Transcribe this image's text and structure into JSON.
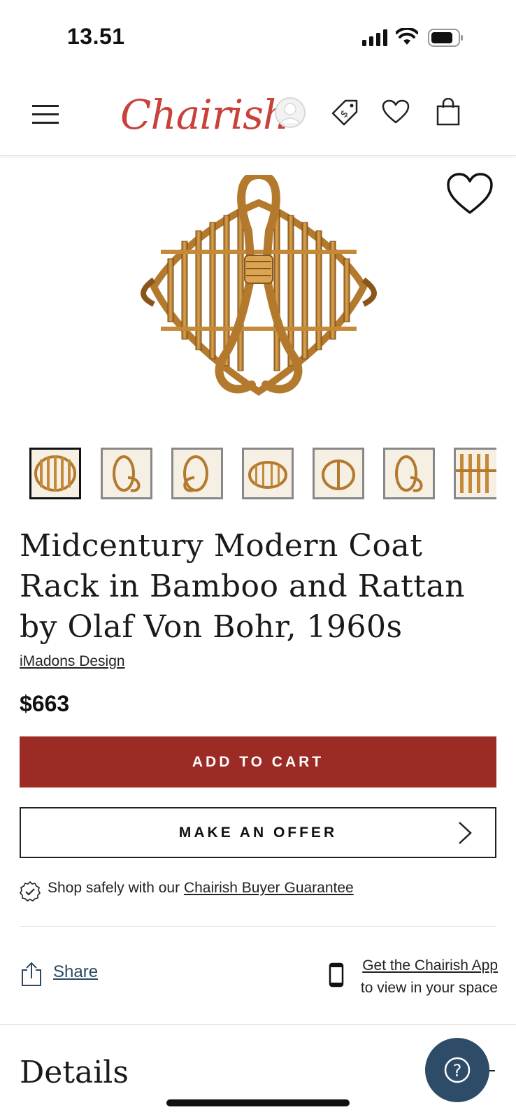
{
  "status_bar": {
    "time": "13.51"
  },
  "header": {
    "logo": "Chairish"
  },
  "thumbnails": {
    "count": 7,
    "active_index": 0
  },
  "product": {
    "title": "Midcentury Modern Coat Rack in Bamboo and Rattan by Olaf Von Bohr, 1960s",
    "seller": "iMadons Design",
    "price": "$663"
  },
  "actions": {
    "add_to_cart": "ADD TO CART",
    "make_offer": "MAKE AN OFFER"
  },
  "guarantee": {
    "prefix": "Shop safely with our ",
    "link": "Chairish Buyer Guarantee"
  },
  "share": {
    "label": "Share"
  },
  "app_promo": {
    "link": "Get the Chairish App",
    "subtitle": "to view in your space"
  },
  "details": {
    "heading": "Details"
  },
  "help": {
    "label": "?"
  },
  "colors": {
    "brand": "#c8413a",
    "cart_button": "#9b2b24",
    "help_button": "#2e4c68"
  }
}
